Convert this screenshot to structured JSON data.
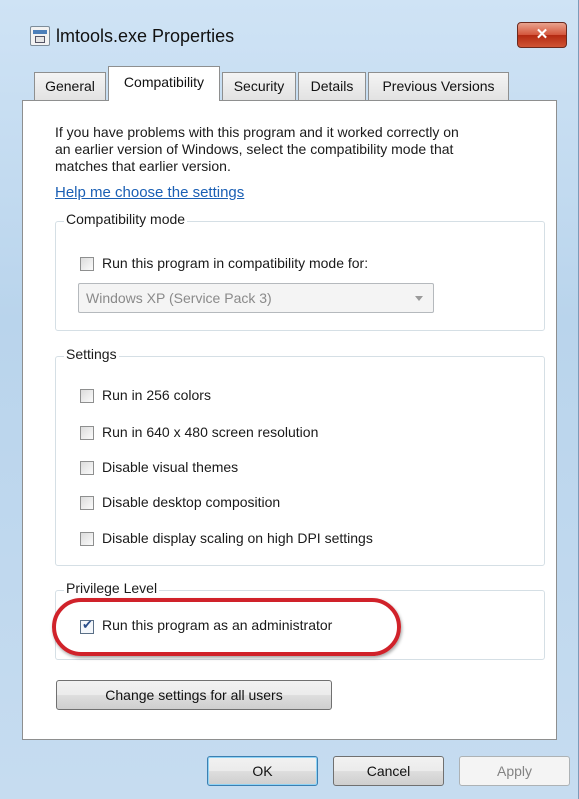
{
  "window": {
    "title": "lmtools.exe Properties",
    "close_glyph": "✕"
  },
  "tabs": [
    {
      "label": "General",
      "active": false
    },
    {
      "label": "Compatibility",
      "active": true
    },
    {
      "label": "Security",
      "active": false
    },
    {
      "label": "Details",
      "active": false
    },
    {
      "label": "Previous Versions",
      "active": false
    }
  ],
  "intro": {
    "line1": "If you have problems with this program and it worked correctly on",
    "line2": "an earlier version of Windows, select the compatibility mode that",
    "line3": "matches that earlier version.",
    "help_link": "Help me choose the settings"
  },
  "compat_mode": {
    "legend": "Compatibility mode",
    "checkbox_label": "Run this program in compatibility mode for:",
    "checked": false,
    "selected_os": "Windows XP (Service Pack 3)"
  },
  "settings": {
    "legend": "Settings",
    "items": [
      {
        "label": "Run in 256 colors",
        "checked": false
      },
      {
        "label": "Run in 640 x 480 screen resolution",
        "checked": false
      },
      {
        "label": "Disable visual themes",
        "checked": false
      },
      {
        "label": "Disable desktop composition",
        "checked": false
      },
      {
        "label": "Disable display scaling on high DPI settings",
        "checked": false
      }
    ]
  },
  "privilege": {
    "legend": "Privilege Level",
    "checkbox_label": "Run this program as an administrator",
    "checked": true
  },
  "buttons": {
    "change_all": "Change settings for all users",
    "ok": "OK",
    "cancel": "Cancel",
    "apply": "Apply"
  },
  "colors": {
    "highlight_ring": "#d0222a",
    "link": "#1a5fb4",
    "close_button": "#c8432a"
  }
}
